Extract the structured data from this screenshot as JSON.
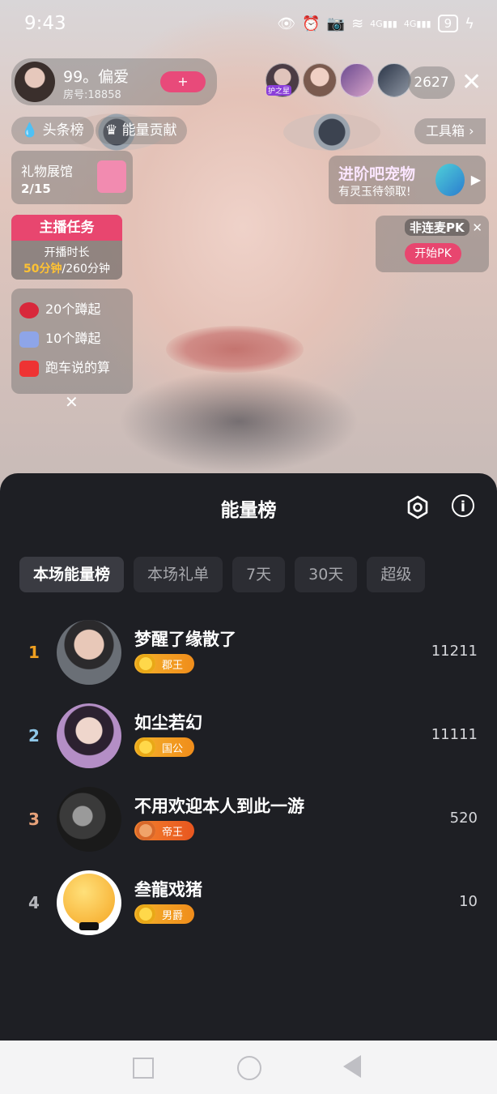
{
  "status_bar": {
    "time": "9:43",
    "signal1": "4G",
    "signal2": "4G",
    "battery": "9"
  },
  "live": {
    "host_name": "99。偏爱",
    "room_id": "房号:18858",
    "follow_label": "+",
    "viewer_count": "2627",
    "viewer_badge": "护之星",
    "tags": {
      "headline": "头条榜",
      "energy": "能量贡献"
    },
    "toolbox": "工具箱",
    "gift_hall": {
      "title": "礼物展馆",
      "progress": "2/15"
    },
    "anchor_task": {
      "title": "主播任务",
      "line1": "开播时长",
      "current": "50分钟",
      "target": "/260分钟"
    },
    "gift_goals": [
      "20个蹲起",
      "10个蹲起",
      "跑车说的算"
    ],
    "pet_promo": {
      "title": "进阶吧宠物",
      "subtitle": "有灵玉待领取!"
    },
    "pk": {
      "title": "非连麦PK",
      "button": "开始PK"
    }
  },
  "sheet": {
    "title": "能量榜",
    "tabs": [
      "本场能量榜",
      "本场礼单",
      "7天",
      "30天",
      "超级"
    ],
    "active_tab": 0,
    "ranks": [
      {
        "rank": "1",
        "name": "梦醒了缘散了",
        "badge": "郡王",
        "score": "11211",
        "color": "#f0a020"
      },
      {
        "rank": "2",
        "name": "如尘若幻",
        "badge": "国公",
        "score": "11111",
        "color": "#8fc7e8"
      },
      {
        "rank": "3",
        "name": "不用欢迎本人到此一游",
        "badge": "帝王",
        "score": "520",
        "color": "#e8a27a"
      },
      {
        "rank": "4",
        "name": "叁龍戏猪",
        "badge": "男爵",
        "score": "10",
        "color": "#b5b6bb"
      }
    ]
  }
}
